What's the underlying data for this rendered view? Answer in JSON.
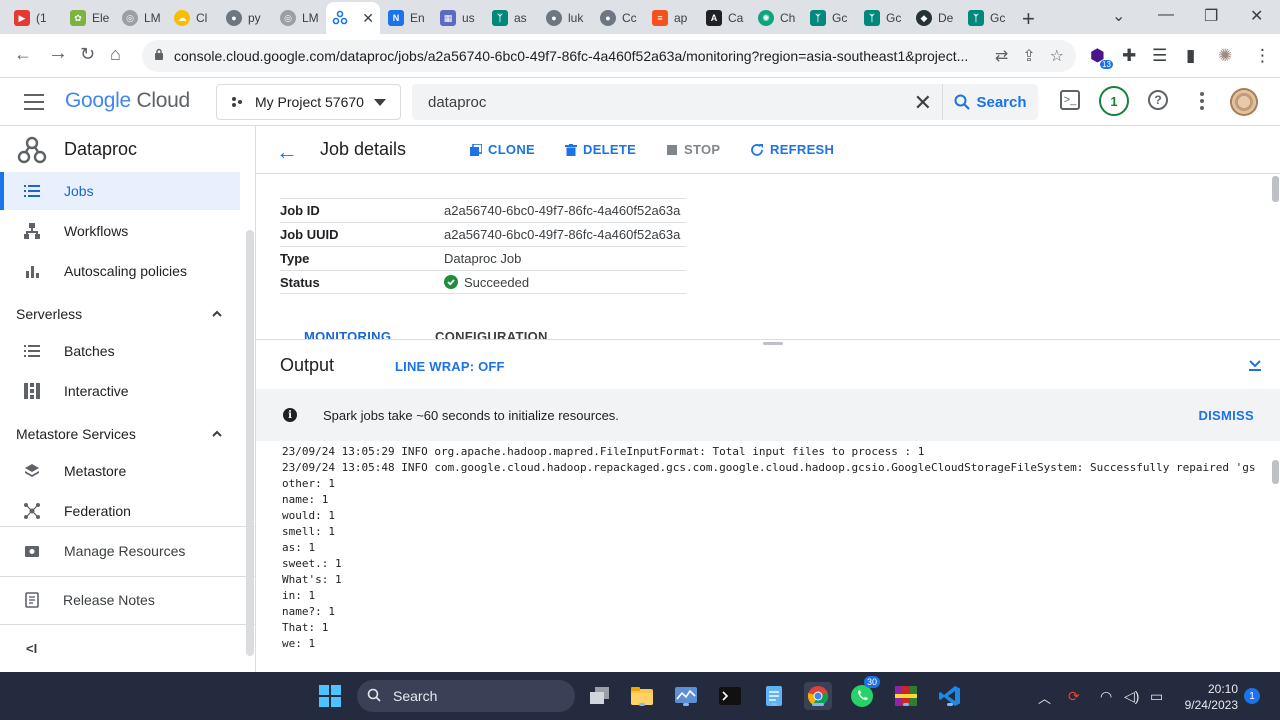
{
  "browser": {
    "tabs": [
      {
        "label": "(1"
      },
      {
        "label": "Ele"
      },
      {
        "label": "LM"
      },
      {
        "label": "Cl"
      },
      {
        "label": "py"
      },
      {
        "label": "LM"
      },
      {
        "label": "",
        "active": true
      },
      {
        "label": "En"
      },
      {
        "label": "us"
      },
      {
        "label": "as"
      },
      {
        "label": "luk"
      },
      {
        "label": "Cc"
      },
      {
        "label": "ap"
      },
      {
        "label": "Ca"
      },
      {
        "label": "Ch"
      },
      {
        "label": "Gc"
      },
      {
        "label": "Gc"
      },
      {
        "label": "De"
      },
      {
        "label": "Gc"
      }
    ],
    "url": "console.cloud.google.com/dataproc/jobs/a2a56740-6bc0-49f7-86fc-4a460f52a63a/monitoring?region=asia-southeast1&project...",
    "extension_badge": "13"
  },
  "console": {
    "logo_google": "Google",
    "logo_cloud": "Cloud",
    "project": "My Project 57670",
    "search_value": "dataproc",
    "search_button": "Search",
    "notifications": "1",
    "help": "?"
  },
  "sidebar": {
    "product": "Dataproc",
    "items": [
      {
        "label": "Jobs"
      },
      {
        "label": "Workflows"
      },
      {
        "label": "Autoscaling policies"
      }
    ],
    "serverless": {
      "title": "Serverless",
      "items": [
        {
          "label": "Batches"
        },
        {
          "label": "Interactive"
        }
      ]
    },
    "metastore": {
      "title": "Metastore Services",
      "items": [
        {
          "label": "Metastore"
        },
        {
          "label": "Federation"
        }
      ]
    },
    "manage_resources": "Manage Resources",
    "release_notes": "Release Notes",
    "collapse": "<I"
  },
  "page": {
    "title": "Job details",
    "actions": {
      "clone": "CLONE",
      "delete": "DELETE",
      "stop": "STOP",
      "refresh": "REFRESH"
    },
    "details": [
      {
        "key": "Job ID",
        "value": "a2a56740-6bc0-49f7-86fc-4a460f52a63a"
      },
      {
        "key": "Job UUID",
        "value": "a2a56740-6bc0-49f7-86fc-4a460f52a63a"
      },
      {
        "key": "Type",
        "value": "Dataproc Job"
      },
      {
        "key": "Status",
        "value": "Succeeded"
      }
    ],
    "tabs": {
      "monitoring": "MONITORING",
      "configuration": "CONFIGURATION"
    },
    "output": {
      "title": "Output",
      "line_wrap": "LINE WRAP: OFF",
      "banner_text": "Spark jobs take ~60 seconds to initialize resources.",
      "dismiss": "DISMISS",
      "log": [
        "23/09/24 13:05:29 INFO org.apache.hadoop.mapred.FileInputFormat: Total input files to process : 1",
        "23/09/24 13:05:48 INFO com.google.cloud.hadoop.repackaged.gcs.com.google.cloud.hadoop.gcsio.GoogleCloudStorageFileSystem: Successfully repaired 'gs",
        "other: 1",
        "name: 1",
        "would: 1",
        "smell: 1",
        "as: 1",
        "sweet.: 1",
        "What's: 1",
        "in: 1",
        "name?: 1",
        "That: 1",
        "we: 1"
      ]
    }
  },
  "taskbar": {
    "search": "Search",
    "whatsapp_badge": "30",
    "time": "20:10",
    "date": "9/24/2023",
    "notif_count": "1"
  },
  "colors": {
    "accent": "#1a73e8",
    "success": "#1e8e3e",
    "taskbar": "#242b3e"
  }
}
